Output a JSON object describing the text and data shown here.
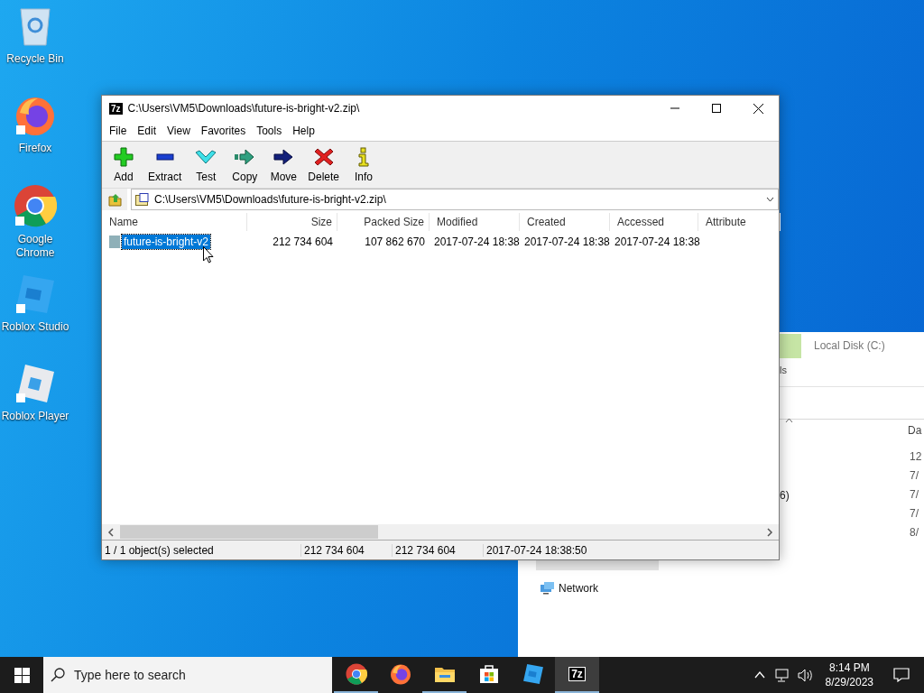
{
  "desktop_icons": [
    {
      "label": "Recycle Bin",
      "kind": "recycle"
    },
    {
      "label": "Firefox",
      "kind": "firefox"
    },
    {
      "label": "Google Chrome",
      "kind": "chrome"
    },
    {
      "label": "Roblox Studio",
      "kind": "studio"
    },
    {
      "label": "Roblox Player",
      "kind": "player"
    }
  ],
  "background_window": {
    "ribbon_tab": "Local Disk (C:)",
    "ribbon_fragment": "ls",
    "column_fragment": "Da",
    "item_fragment": "6)",
    "date_fragments": [
      "12",
      "7/",
      "7/",
      "7/",
      "8/"
    ],
    "nav_items": [
      "Network"
    ]
  },
  "window": {
    "icon_label": "7z",
    "title": "C:\\Users\\VM5\\Downloads\\future-is-bright-v2.zip\\",
    "menu": [
      "File",
      "Edit",
      "View",
      "Favorites",
      "Tools",
      "Help"
    ],
    "toolbar": [
      {
        "label": "Add",
        "kind": "add"
      },
      {
        "label": "Extract",
        "kind": "extract"
      },
      {
        "label": "Test",
        "kind": "test"
      },
      {
        "label": "Copy",
        "kind": "copy"
      },
      {
        "label": "Move",
        "kind": "move"
      },
      {
        "label": "Delete",
        "kind": "delete"
      },
      {
        "label": "Info",
        "kind": "info"
      }
    ],
    "address": "C:\\Users\\VM5\\Downloads\\future-is-bright-v2.zip\\",
    "columns": [
      "Name",
      "Size",
      "Packed Size",
      "Modified",
      "Created",
      "Accessed",
      "Attribute"
    ],
    "rows": [
      {
        "cells": [
          "future-is-bright-v2",
          "212 734 604",
          "107 862 670",
          "2017-07-24 18:38",
          "2017-07-24 18:38",
          "2017-07-24 18:38"
        ],
        "selected": true
      }
    ],
    "status": [
      "1 / 1 object(s) selected",
      "212 734 604",
      "212 734 604",
      "2017-07-24 18:38:50"
    ]
  },
  "taskbar": {
    "search_placeholder": "Type here to search",
    "apps": [
      {
        "kind": "chrome",
        "running": true,
        "active": false
      },
      {
        "kind": "firefox",
        "running": false,
        "active": false
      },
      {
        "kind": "explorer",
        "running": true,
        "active": false
      },
      {
        "kind": "store",
        "running": false,
        "active": false
      },
      {
        "kind": "roblox",
        "running": false,
        "active": false
      },
      {
        "kind": "sevenzip",
        "label": "7z",
        "running": true,
        "active": true
      }
    ],
    "time": "8:14 PM",
    "date": "8/29/2023"
  }
}
